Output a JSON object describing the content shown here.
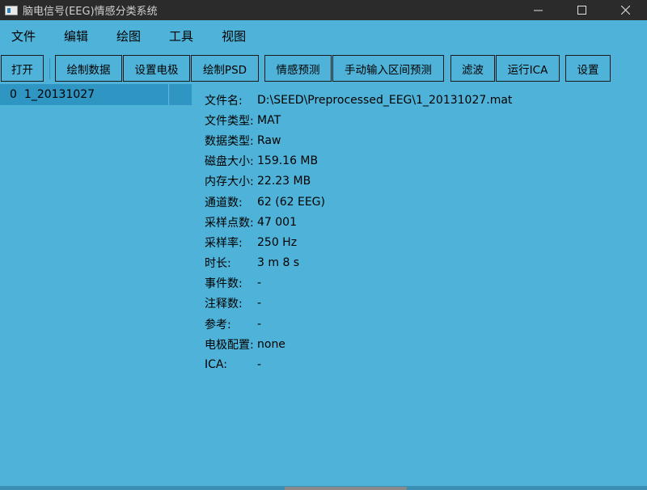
{
  "window": {
    "title": "脑电信号(EEG)情感分类系统"
  },
  "menu": [
    "文件",
    "编辑",
    "绘图",
    "工具",
    "视图"
  ],
  "toolbar": {
    "open": "打开",
    "plot_data": "绘制数据",
    "set_electrodes": "设置电极",
    "plot_psd": "绘制PSD",
    "emotion_predict": "情感预测",
    "manual_interval_predict": "手动输入区间预测",
    "filter": "滤波",
    "run_ica": "运行ICA",
    "settings": "设置"
  },
  "file_list": [
    {
      "index": "0",
      "name": "1_20131027"
    }
  ],
  "info": [
    {
      "key": "文件名:",
      "value": "D:\\SEED\\Preprocessed_EEG\\1_20131027.mat"
    },
    {
      "key": "文件类型:",
      "value": "MAT"
    },
    {
      "key": "数据类型:",
      "value": "Raw"
    },
    {
      "key": "磁盘大小:",
      "value": "159.16 MB"
    },
    {
      "key": "内存大小:",
      "value": "22.23 MB"
    },
    {
      "key": "通道数:",
      "value": "62 (62 EEG)"
    },
    {
      "key": "采样点数:",
      "value": "47 001"
    },
    {
      "key": "采样率:",
      "value": "250 Hz"
    },
    {
      "key": "时长:",
      "value": "3 m 8 s"
    },
    {
      "key": "事件数:",
      "value": "-"
    },
    {
      "key": "注释数:",
      "value": "-"
    },
    {
      "key": "参考:",
      "value": "-"
    },
    {
      "key": "电极配置:",
      "value": "none"
    },
    {
      "key": "ICA:",
      "value": "-"
    }
  ],
  "colors": {
    "background": "#4fb3d9",
    "selected_row": "#2f95c3",
    "titlebar": "#2b2b2b"
  }
}
